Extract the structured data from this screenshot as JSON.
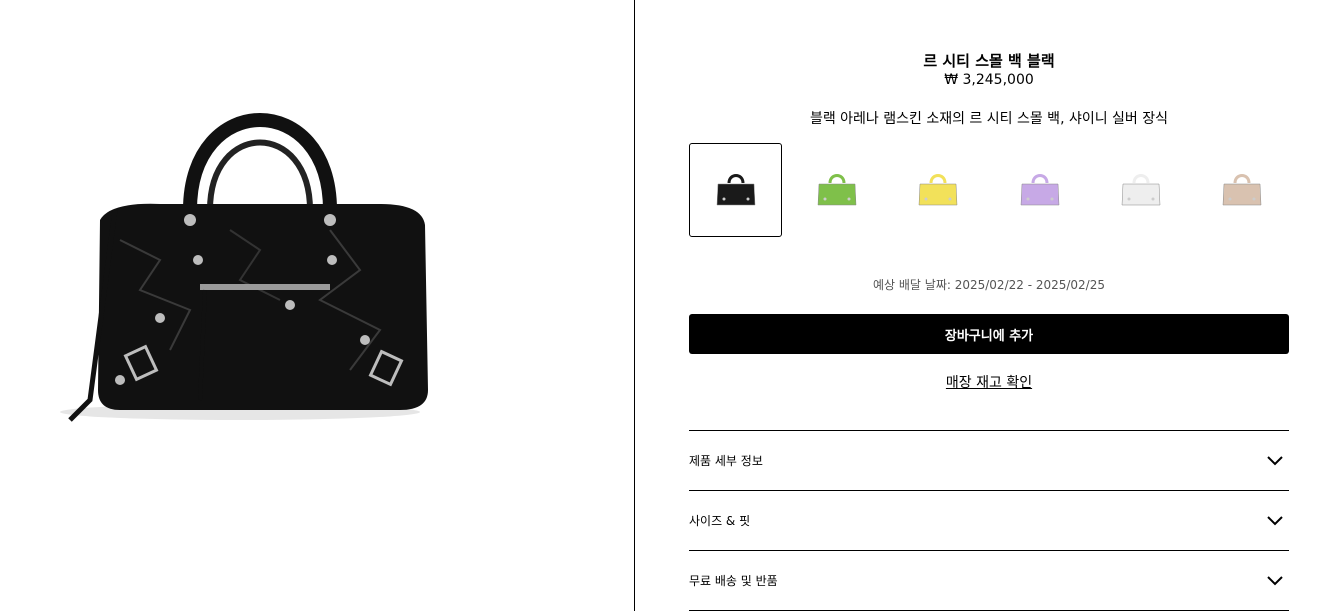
{
  "product": {
    "title": "르 시티 스몰 백 블랙",
    "price": "₩ 3,245,000",
    "description": "블랙 아레나 램스킨 소재의 르 시티 스몰 백, 샤이니 실버 장식"
  },
  "swatches": [
    {
      "name": "black",
      "color": "#1a1a1a",
      "selected": true
    },
    {
      "name": "green",
      "color": "#7fc04a",
      "selected": false
    },
    {
      "name": "yellow",
      "color": "#f2e15a",
      "selected": false
    },
    {
      "name": "lilac",
      "color": "#c7a9e6",
      "selected": false
    },
    {
      "name": "white",
      "color": "#eeeeee",
      "selected": false
    },
    {
      "name": "beige",
      "color": "#d9c2b0",
      "selected": false
    }
  ],
  "delivery": "예상 배달 날짜: 2025/02/22 - 2025/02/25",
  "actions": {
    "add_to_cart": "장바구니에 추가",
    "check_stock": "매장 재고 확인"
  },
  "accordion": [
    {
      "label": "제품 세부 정보",
      "icon": "chevron-down-icon"
    },
    {
      "label": "사이즈 & 핏",
      "icon": "chevron-down-icon"
    },
    {
      "label": "무료 배송 및 반품",
      "icon": "chevron-down-icon"
    }
  ]
}
